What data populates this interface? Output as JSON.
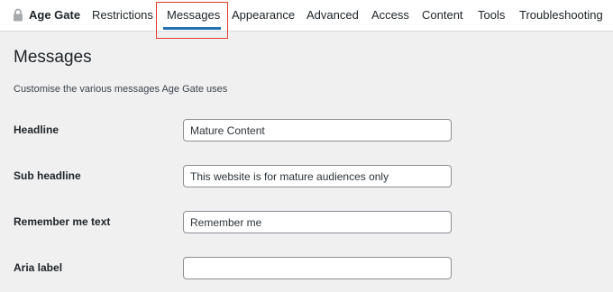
{
  "brand": {
    "label": "Age Gate",
    "icon": "lock-icon"
  },
  "nav": {
    "tabs": [
      {
        "label": "Restrictions"
      },
      {
        "label": "Messages",
        "active": true
      },
      {
        "label": "Appearance"
      },
      {
        "label": "Advanced"
      },
      {
        "label": "Access"
      },
      {
        "label": "Content"
      },
      {
        "label": "Tools"
      },
      {
        "label": "Troubleshooting"
      }
    ],
    "active_color": "#2271b1",
    "highlight_color": "#e23b2d"
  },
  "page": {
    "title": "Messages",
    "description": "Customise the various messages Age Gate uses"
  },
  "fields": [
    {
      "label": "Headline",
      "value": "Mature Content"
    },
    {
      "label": "Sub headline",
      "value": "This website is for mature audiences only"
    },
    {
      "label": "Remember me text",
      "value": "Remember me"
    },
    {
      "label": "Aria label",
      "value": ""
    }
  ]
}
